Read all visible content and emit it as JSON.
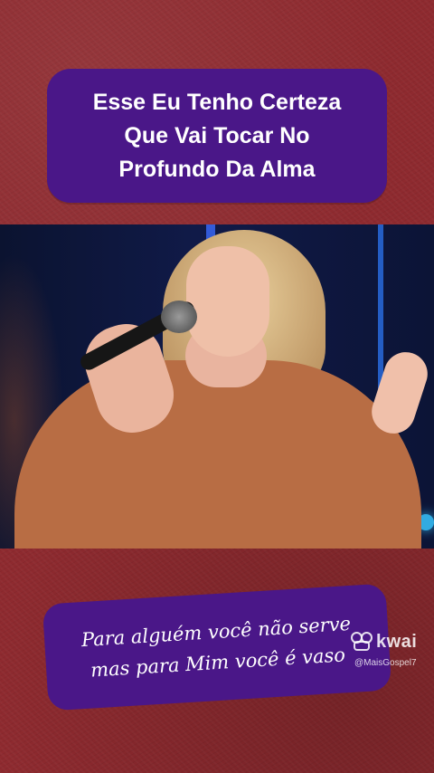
{
  "top_banner": {
    "line1": "Esse Eu Tenho Certeza",
    "line2": "Que Vai Tocar No",
    "line3": "Profundo Da Alma"
  },
  "bottom_banner": {
    "line1": "Para alguém você não serve",
    "line2": "mas para Mim você é vaso"
  },
  "watermark": {
    "brand": "kwai",
    "handle": "@MaisGospel7"
  },
  "colors": {
    "background": "#8e2a2f",
    "banner": "#4a1788",
    "text": "#ffffff"
  }
}
